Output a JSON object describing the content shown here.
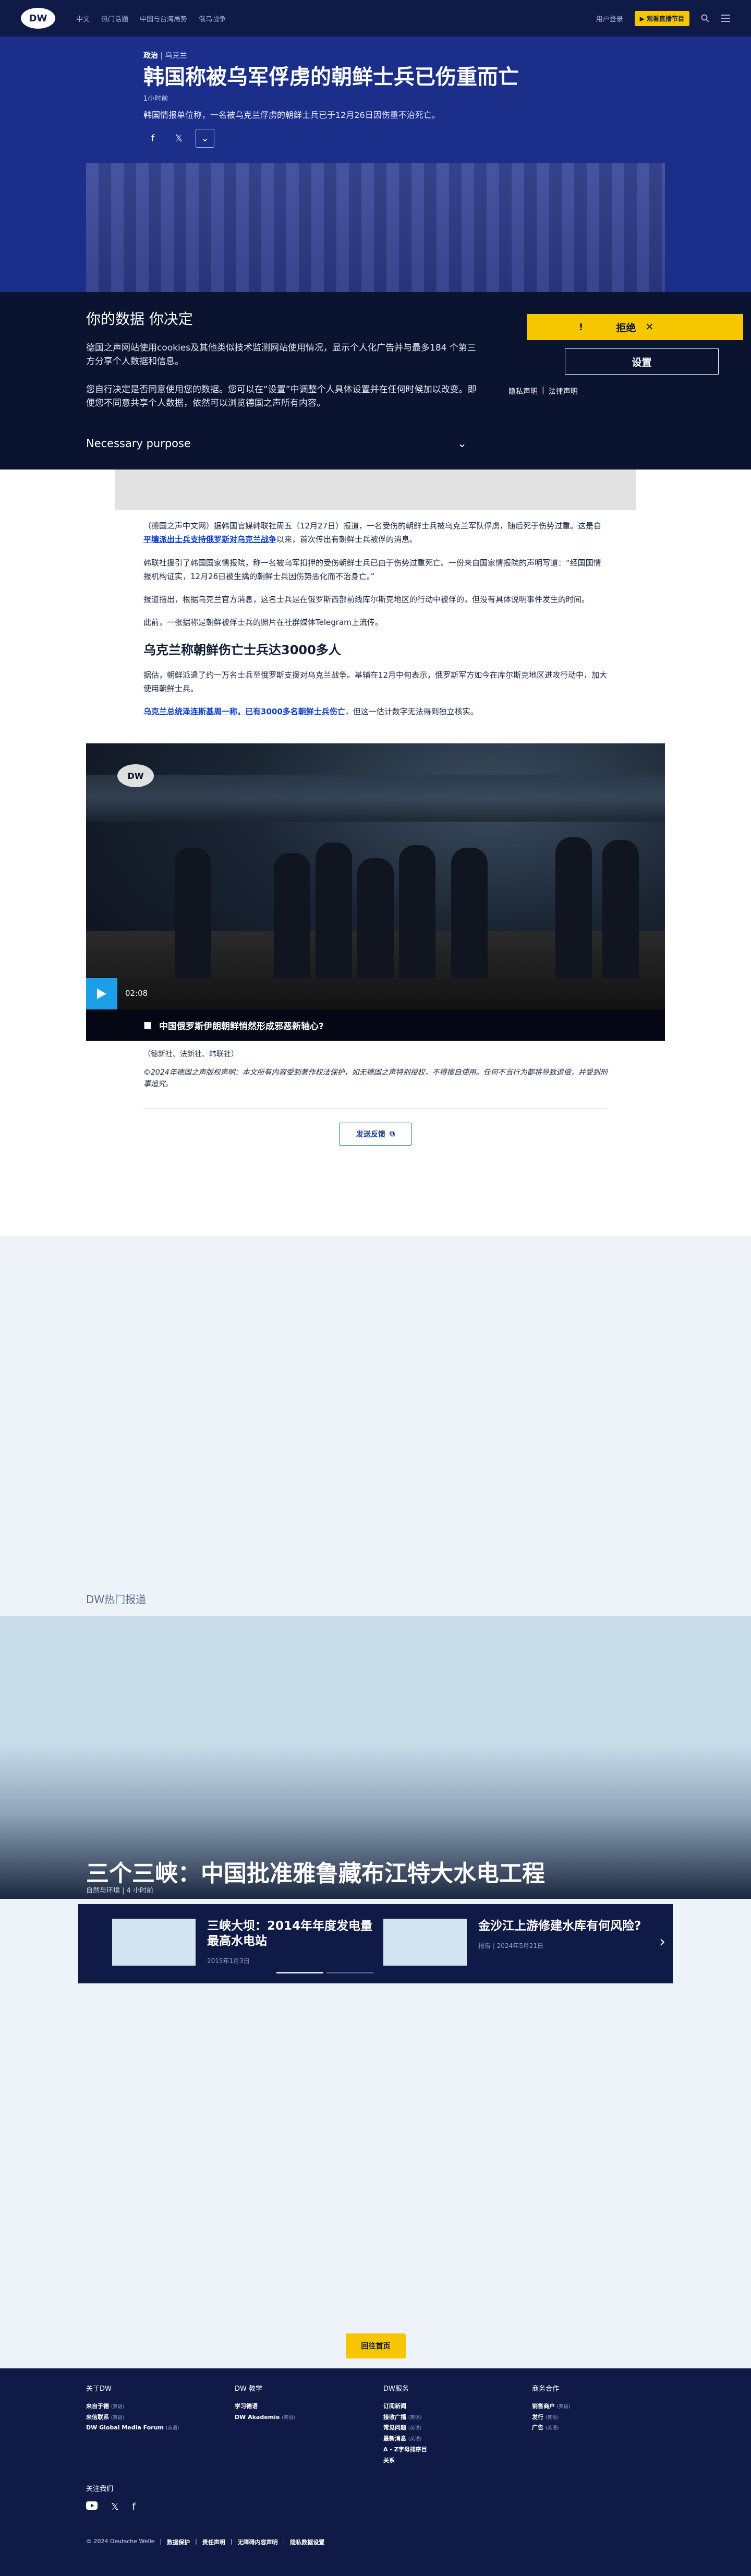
{
  "nav": {
    "logo": "DW",
    "links": [
      "中文",
      "热门话题",
      "中国与台湾局势",
      "俄乌战争"
    ],
    "login": "用户登录",
    "live": "观看直播节目"
  },
  "article": {
    "breadcrumb_category": "政治",
    "breadcrumb_region": "乌克兰",
    "title": "韩国称被乌军俘虏的朝鲜士兵已伤重而亡",
    "date": "1小时前",
    "lead": "韩国情报单位称，一名被乌克兰俘虏的朝鲜士兵已于12月26日因伤重不治死亡。",
    "paragraphs": [
      {
        "pre": "（德国之声中文网）据韩国官媒韩联社周五（12月27日）报道，一名受伤的朝鲜士兵被乌克兰军队俘虏，随后死于伤势过重。这是自",
        "link": "平壤派出士兵支持俄罗斯对乌克兰战争",
        "post": "以来，首次传出有朝鲜士兵被俘的消息。"
      },
      {
        "pre": "韩联社援引了韩国国家情报院，称一名被乌军扣押的受伤朝鲜士兵已由于伤势过重死亡。一份来自国家情报院的声明写道：“经国国情报机构证实，12月26日被生擒的朝鲜士兵因伤势恶化而不治身亡。”",
        "link": "",
        "post": ""
      },
      {
        "pre": "报道指出，根据乌克兰官方消息，这名士兵是在俄罗斯西部前线库尔斯克地区的行动中被俘的，但没有具体说明事件发生的时间。",
        "link": "",
        "post": ""
      },
      {
        "pre": "此前，一张据称是朝鲜被俘士兵的照片在社群媒体Telegram上流传。",
        "link": "",
        "post": ""
      }
    ],
    "subheading": "乌克兰称朝鲜伤亡士兵达3000多人",
    "paragraph_after": "据估，朝鲜派遣了约一万名士兵至俄罗斯支援对乌克兰战争。基辅在12月中旬表示，俄罗斯军方如今在库尔斯克地区进攻行动中，加大使用朝鲜士兵。",
    "paragraph_link": {
      "link": "乌克兰总统泽连斯基周一称，已有3000多名朝鲜士兵伤亡",
      "post": "，但这一估计数字无法得到独立核实。"
    },
    "video": {
      "duration": "02:08",
      "caption": "中国俄罗斯伊朗朝鲜悄然形成邪恶新轴心?",
      "logo": "DW"
    },
    "photo_credit": "（德新社、法新社、韩联社）",
    "copyright": "©2024年德国之声版权声明：本文所有内容受到著作权法保护，如无德国之声特别授权，不得擅自使用。任何不当行为都将导致追偿，并受到刑事追究。",
    "feedback": "发送反馈"
  },
  "consent": {
    "title": "你的数据 你决定",
    "p1": "德国之声网站使用cookies及其他类似技术监测网站使用情况，显示个人化广告并与最多184 个第三方分享个人数据和信息。",
    "p2": "您自行决定是否同意使用您的数据。您可以在“设置”中调整个人具体设置并在任何时候加以改变。即便您不同意共享个人数据，依然可以浏览德国之声所有内容。",
    "purpose": "Necessary purpose",
    "reject": "拒绝",
    "settings": "设置",
    "privacy": "隐私声明",
    "legal": "法律声明"
  },
  "hot": {
    "label": "DW热门报道",
    "title": "三个三峡：中国批准雅鲁藏布江特大水电工程",
    "meta": "自然与环境 | 4 小时前",
    "cards": [
      {
        "title": "三峡大坝：2014年年度发电量最高水电站",
        "sub": "2015年1月3日"
      },
      {
        "title": "金沙江上游修建水库有何风险?",
        "sub": "报告 | 2024年5月21日"
      }
    ]
  },
  "home_button": "回往首页",
  "footer": {
    "cols": [
      {
        "heading": "关于DW",
        "items": [
          {
            "name": "来自于德",
            "tag": "(英语)"
          },
          {
            "name": "来信联系",
            "tag": "(英语)"
          },
          {
            "name": "DW Global Media Forum",
            "tag": "(英语)"
          }
        ]
      },
      {
        "heading": "DW 教学",
        "items": [
          {
            "name": "学习德语",
            "tag": ""
          },
          {
            "name": "DW Akademie",
            "tag": "(英语)"
          }
        ]
      },
      {
        "heading": "DW服务",
        "items": [
          {
            "name": "订阅新闻",
            "tag": ""
          },
          {
            "name": "接收广播",
            "tag": "(英语)"
          },
          {
            "name": "常见问题",
            "tag": "(英语)"
          },
          {
            "name": "最新消息",
            "tag": "(英语)"
          },
          {
            "name": "A - Z字母排序目",
            "tag": ""
          },
          {
            "name": "关系",
            "tag": ""
          }
        ]
      },
      {
        "heading": "商务合作",
        "items": [
          {
            "name": "销售商户",
            "tag": "(英语)"
          },
          {
            "name": "发行",
            "tag": "(英语)"
          },
          {
            "name": "广告",
            "tag": "(英语)"
          }
        ]
      }
    ],
    "follow": "关注我们",
    "copyright": "© 2024 Deutsche Welle",
    "legal_links": [
      "数据保护",
      "责任声明",
      "无障碍内容声明",
      "隐私数据设置"
    ]
  }
}
